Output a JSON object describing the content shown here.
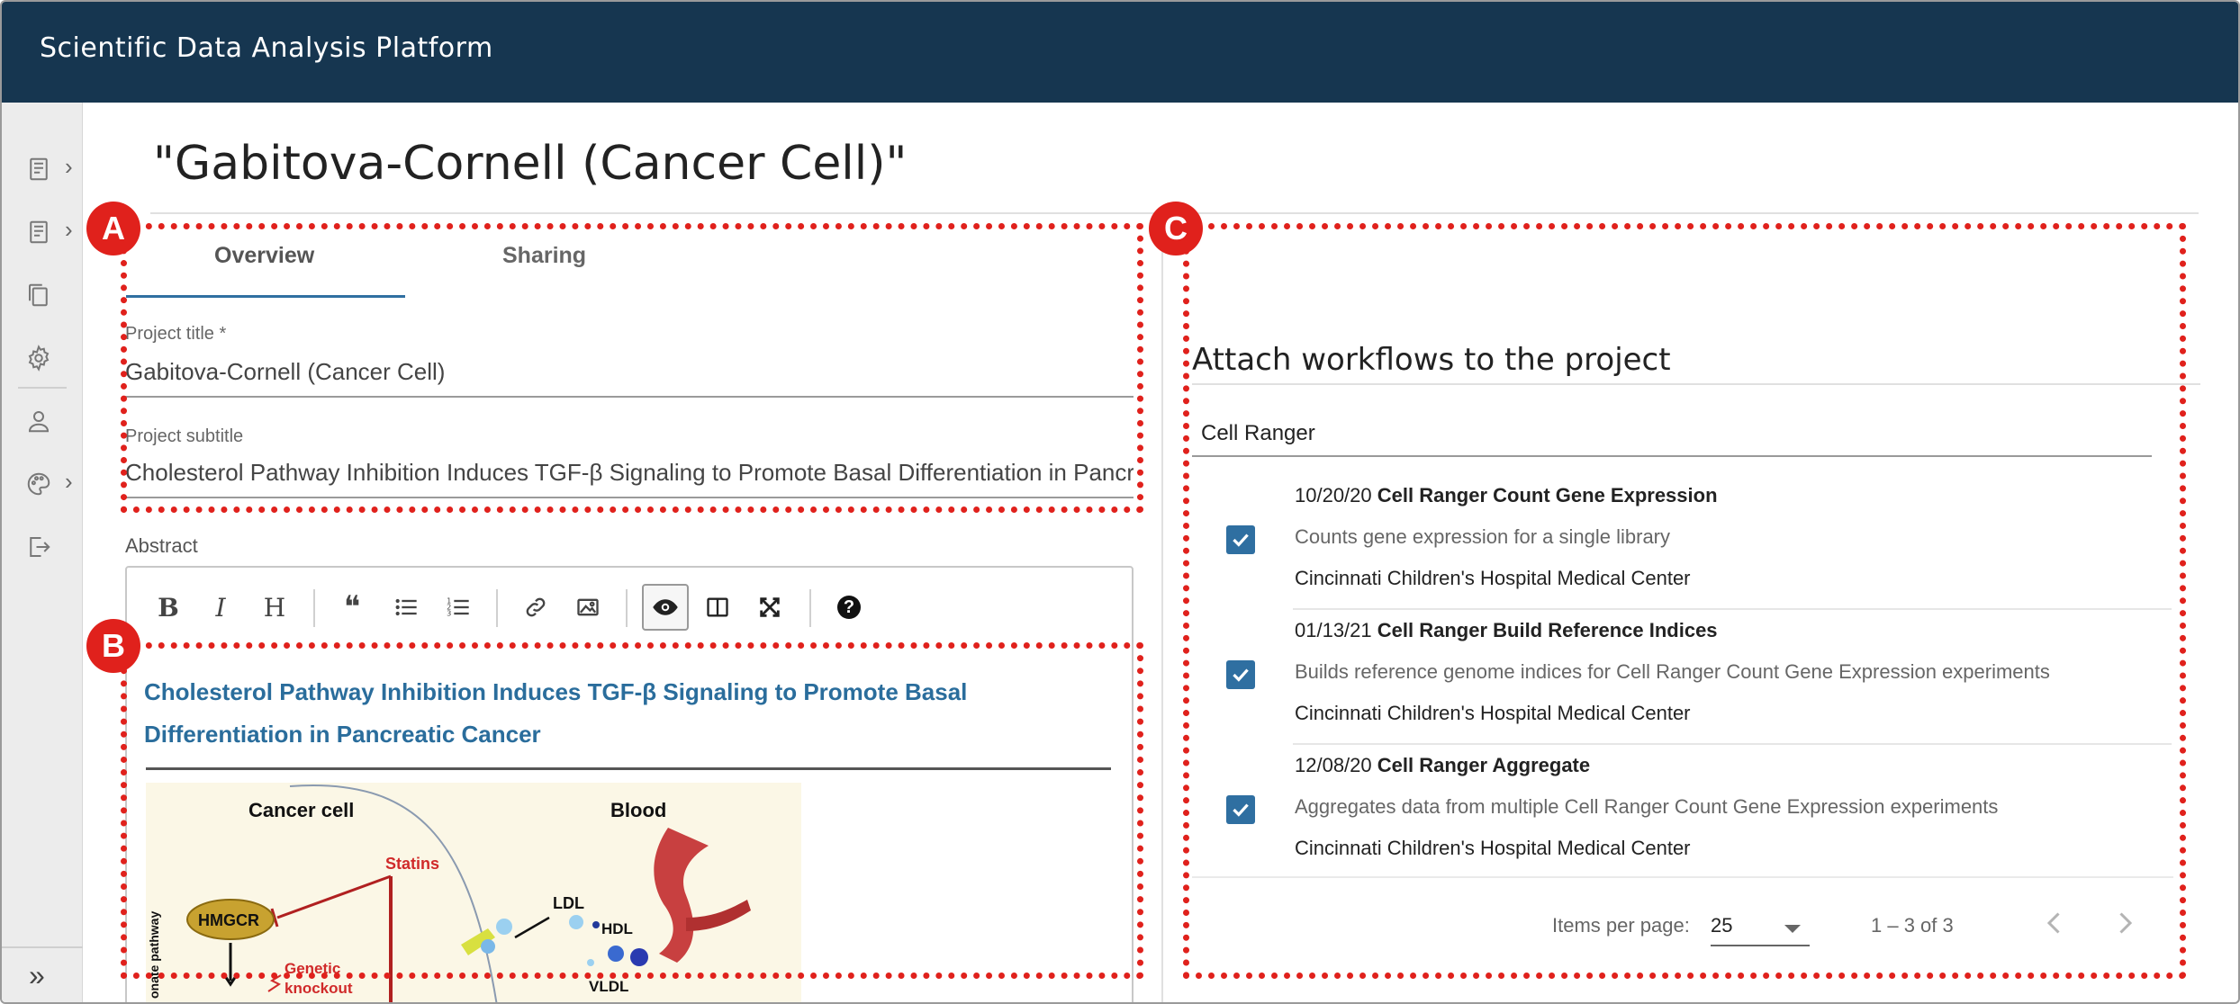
{
  "app": {
    "title": "Scientific Data Analysis Platform"
  },
  "sidebar": {
    "items": [
      {
        "icon": "document-icon",
        "has_chevron": true
      },
      {
        "icon": "document-icon",
        "has_chevron": true
      },
      {
        "icon": "copy-icon",
        "has_chevron": false
      },
      {
        "icon": "gear-icon",
        "has_chevron": false
      },
      {
        "icon": "user-icon",
        "has_chevron": false
      },
      {
        "icon": "palette-icon",
        "has_chevron": true
      },
      {
        "icon": "logout-icon",
        "has_chevron": false
      }
    ],
    "expand_label": "»"
  },
  "page": {
    "title": "\"Gabitova-Cornell (Cancer Cell)\""
  },
  "tabs": [
    {
      "label": "Overview",
      "active": true
    },
    {
      "label": "Sharing",
      "active": false
    }
  ],
  "form": {
    "project_title_label": "Project title *",
    "project_title_value": "Gabitova-Cornell (Cancer Cell)",
    "project_subtitle_label": "Project subtitle",
    "project_subtitle_value": "Cholesterol Pathway Inhibition Induces TGF-β Signaling to Promote Basal Differentiation in Pancreatic Cancer",
    "abstract_label": "Abstract"
  },
  "editor": {
    "toolbar": {
      "bold": "B",
      "italic": "I",
      "heading": "H",
      "quote": "❝",
      "help": "?"
    },
    "preview_heading": "Cholesterol Pathway Inhibition Induces TGF-β Signaling to Promote Basal Differentiation in Pancreatic Cancer",
    "figure": {
      "labels": {
        "cancer_cell": "Cancer cell",
        "blood": "Blood",
        "statins": "Statins",
        "hmgcr": "HMGCR",
        "ldl": "LDL",
        "hdl": "HDL",
        "vldl": "VLDL",
        "genetic": "Genetic",
        "knockout": "knockout",
        "pathway_side": "onate pathway"
      }
    }
  },
  "workflows": {
    "title": "Attach workflows to the project",
    "group": "Cell Ranger",
    "items": [
      {
        "date": "10/20/20",
        "name": "Cell Ranger Count Gene Expression",
        "description": "Counts gene expression for a single library",
        "organization": "Cincinnati Children's Hospital Medical Center",
        "checked": true
      },
      {
        "date": "01/13/21",
        "name": "Cell Ranger Build Reference Indices",
        "description": "Builds reference genome indices for Cell Ranger Count Gene Expression experiments",
        "organization": "Cincinnati Children's Hospital Medical Center",
        "checked": true
      },
      {
        "date": "12/08/20",
        "name": "Cell Ranger Aggregate",
        "description": "Aggregates data from multiple Cell Ranger Count Gene Expression experiments",
        "organization": "Cincinnati Children's Hospital Medical Center",
        "checked": true
      }
    ],
    "pagination": {
      "items_per_page_label": "Items per page:",
      "items_per_page_value": "25",
      "range": "1 – 3 of 3"
    }
  },
  "callouts": {
    "a": "A",
    "b": "B",
    "c": "C",
    "color": "#e0211c"
  },
  "colors": {
    "header_bg": "#163650",
    "accent": "#2f6fa1",
    "link": "#2a6d9c"
  }
}
